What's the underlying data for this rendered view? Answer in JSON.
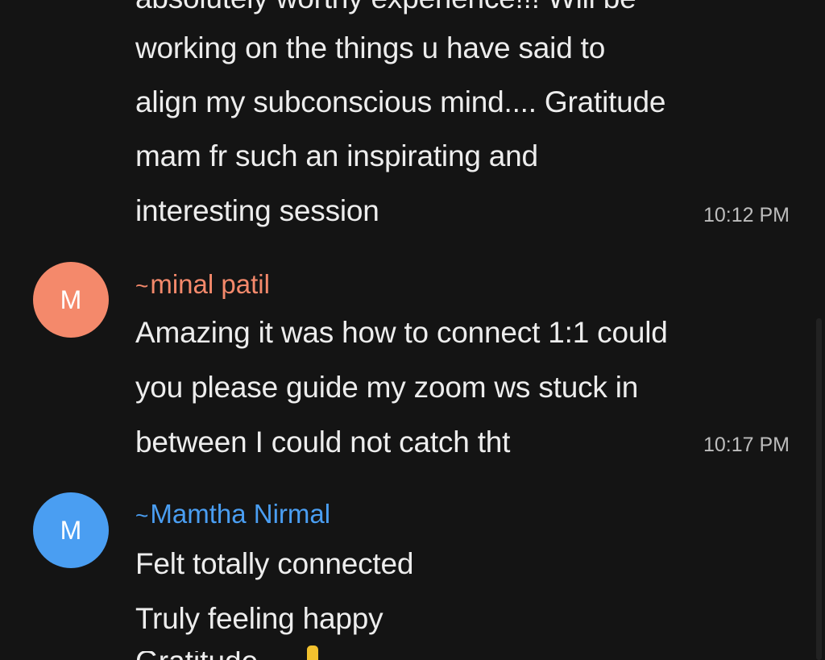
{
  "messages": [
    {
      "lines": [
        "absolutely worthy experience!!! Will be",
        "working on the things u have said to",
        "align my subconscious mind.... Gratitude",
        "mam fr such an inspirating and",
        "interesting session"
      ],
      "time": "10:12 PM"
    },
    {
      "avatar": "M",
      "avatar_color": "#F4896B",
      "sender_prefix": "~",
      "sender": "minal patil",
      "sender_color": "#F4896B",
      "lines": [
        "Amazing it was how to connect 1:1 could",
        "you please guide my zoom ws stuck in",
        "between I could not catch tht"
      ],
      "time": "10:17 PM"
    },
    {
      "avatar": "M",
      "avatar_color": "#4A9EF2",
      "sender_prefix": "~",
      "sender": "Mamtha Nirmal",
      "sender_color": "#4A9EF2",
      "lines": [
        "Felt totally connected",
        "Truly feeling happy",
        "Gratitude"
      ],
      "emoji": "raised-hand-emoji"
    }
  ]
}
